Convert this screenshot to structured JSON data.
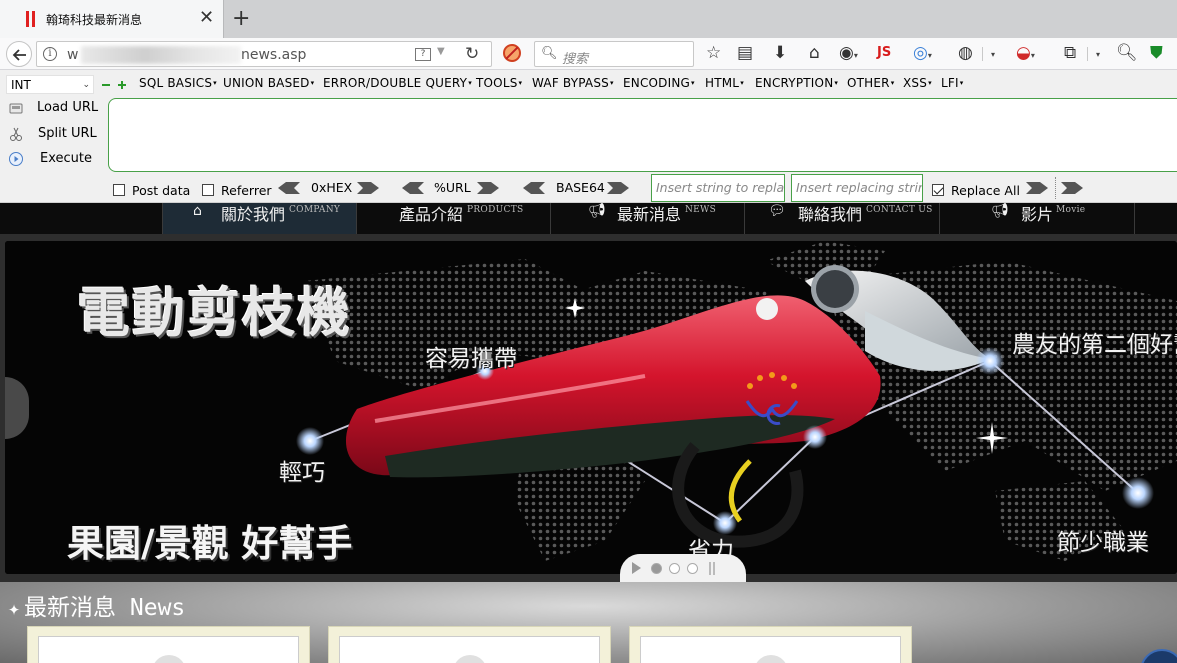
{
  "browser": {
    "tab_title": "翰琦科技最新消息",
    "url_visible": "w",
    "url_tail": "news.asp",
    "search_placeholder": "搜索",
    "toolbar_js_label": "JS"
  },
  "hackbar": {
    "type_select": "INT",
    "menus": [
      "SQL BASICS",
      "UNION BASED",
      "ERROR/DOUBLE QUERY",
      "TOOLS",
      "WAF BYPASS",
      "ENCODING",
      "HTML",
      "ENCRYPTION",
      "OTHER",
      "XSS",
      "LFI"
    ],
    "side_buttons": {
      "load": "Load URL",
      "split": "Split URL",
      "execute": "Execute"
    },
    "url_text": "",
    "options": {
      "post_data": "Post data",
      "referrer": "Referrer",
      "hex": "0xHEX",
      "url": "%URL",
      "base64": "BASE64",
      "replace_find_placeholder": "Insert string to replace",
      "replace_with_placeholder": "Insert replacing string",
      "replace_all": "Replace All",
      "replace_all_checked": true
    }
  },
  "site": {
    "nav": [
      {
        "zh": "關於我們",
        "en": "COMPANY",
        "icon": "home-icon",
        "active": true
      },
      {
        "zh": "產品介紹",
        "en": "PRODUCTS",
        "icon": "",
        "active": false
      },
      {
        "zh": "最新消息",
        "en": "NEWS",
        "icon": "megaphone-icon",
        "active": false
      },
      {
        "zh": "聯絡我們",
        "en": "CONTACT US",
        "icon": "chat-icon",
        "active": false
      },
      {
        "zh": "影片",
        "en": "Movie",
        "icon": "megaphone-icon",
        "active": false
      }
    ],
    "hero": {
      "title": "電動剪枝機",
      "subtitle": "果園/景觀 好幫手",
      "callouts": {
        "portable": "容易攜帶",
        "light": "輕巧",
        "saving": "省力",
        "farmer": "農友的第二個好幫手",
        "labor": "節少職業"
      },
      "slides_total": 4,
      "slide_active": 1
    },
    "news_heading": "最新消息 News"
  },
  "colors": {
    "accent_green": "#48a048",
    "tab_indicator": "#e02020",
    "product_red": "#d4142c"
  }
}
